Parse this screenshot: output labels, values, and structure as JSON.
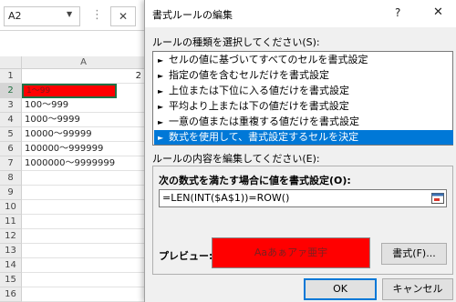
{
  "formula_bar": {
    "name_box": "A2",
    "name_box_arrow": "▼",
    "dots": "⋮",
    "cancel_glyph": "✕"
  },
  "sheet": {
    "column_header": "A",
    "rows": [
      {
        "num": "1",
        "value": "2",
        "align": "right"
      },
      {
        "num": "2",
        "value": "1〜99",
        "highlight": true
      },
      {
        "num": "3",
        "value": "100〜999"
      },
      {
        "num": "4",
        "value": "1000〜9999"
      },
      {
        "num": "5",
        "value": "10000〜99999"
      },
      {
        "num": "6",
        "value": "100000〜999999"
      },
      {
        "num": "7",
        "value": "1000000〜9999999"
      },
      {
        "num": "8",
        "value": ""
      },
      {
        "num": "9",
        "value": ""
      },
      {
        "num": "10",
        "value": ""
      },
      {
        "num": "11",
        "value": ""
      },
      {
        "num": "12",
        "value": ""
      },
      {
        "num": "13",
        "value": ""
      },
      {
        "num": "14",
        "value": ""
      },
      {
        "num": "15",
        "value": ""
      },
      {
        "num": "16",
        "value": ""
      }
    ],
    "highlight_color": "#ff0000"
  },
  "dialog": {
    "title": "書式ルールの編集",
    "help_glyph": "?",
    "close_glyph": "✕",
    "rule_type_label": "ルールの種類を選択してください(S):",
    "rule_types": [
      "セルの値に基づいてすべてのセルを書式設定",
      "指定の値を含むセルだけを書式設定",
      "上位または下位に入る値だけを書式設定",
      "平均より上または下の値だけを書式設定",
      "一意の値または重複する値だけを書式設定",
      "数式を使用して、書式設定するセルを決定"
    ],
    "selected_rule_index": 5,
    "rule_content_label": "ルールの内容を編集してください(E):",
    "formula_condition_label": "次の数式を満たす場合に値を書式設定(O):",
    "formula": "=LEN(INT($A$1))=ROW()",
    "preview_label": "プレビュー:",
    "preview_text": "Aaあぁアァ亜宇",
    "preview_color": "#ff0000",
    "format_button": "書式(F)...",
    "ok_button": "OK",
    "cancel_button": "キャンセル",
    "selection_color": "#0078d7"
  }
}
